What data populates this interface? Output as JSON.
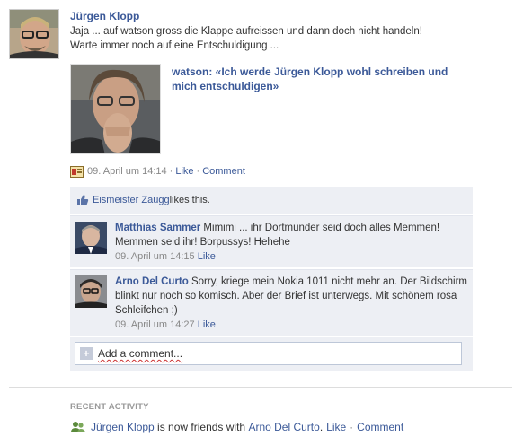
{
  "post": {
    "author": "Jürgen Klopp",
    "text_line1": "Jaja ... auf watson gross die Klappe aufreissen und dann doch nicht handeln!",
    "text_line2": "Warte immer noch auf eine Entschuldigung ...",
    "attachment": {
      "title_line1": "watson: «Ich werde Jürgen Klopp wohl schreiben und",
      "title_line2": "mich entschuldigen»"
    },
    "meta": {
      "timestamp": "09. April um 14:14",
      "sep": "·",
      "like": "Like",
      "comment": "Comment"
    }
  },
  "likes": {
    "name": "Eismeister Zaugg",
    "suffix": " likes this."
  },
  "comments": [
    {
      "author": "Matthias Sammer",
      "text": " Mimimi ... ihr Dortmunder seid doch alles Memmen! Memmen seid ihr! Borpussys! Hehehe",
      "timestamp": "09. April um 14:15",
      "like": "Like"
    },
    {
      "author": "Arno Del Curto",
      "text": " Sorry, kriege mein Nokia 1011 nicht mehr an. Der Bildschirm blinkt nur noch so komisch. Aber der Brief ist unterwegs. Mit schönem rosa Schleifchen ;)",
      "timestamp": "09. April um 14:27",
      "like": "Like"
    }
  ],
  "add_comment": {
    "placeholder": "Add a comment..."
  },
  "recent_activity": {
    "title": "RECENT ACTIVITY",
    "actor": "Jürgen Klopp",
    "middle": " is now friends with ",
    "target": "Arno Del Curto",
    "end": ".",
    "like": "Like",
    "sep": "·",
    "comment": "Comment"
  },
  "colors": {
    "link": "#3b5998",
    "feedback_bg": "#edeff4",
    "meta_grey": "#888888"
  }
}
